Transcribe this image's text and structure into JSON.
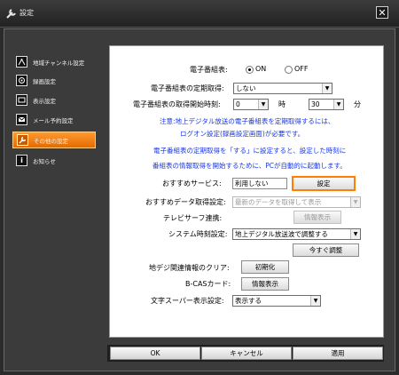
{
  "window": {
    "title": "設定",
    "close_label": "✕"
  },
  "sidebar": {
    "items": [
      {
        "label": "地域チャンネル設定",
        "icon": "tv-antenna-icon"
      },
      {
        "label": "録画設定",
        "icon": "record-icon"
      },
      {
        "label": "表示設定",
        "icon": "display-icon"
      },
      {
        "label": "メール予約設定",
        "icon": "mail-icon"
      },
      {
        "label": "その他の設定",
        "icon": "wrench-icon",
        "active": true
      },
      {
        "label": "お知らせ",
        "icon": "info-icon"
      }
    ]
  },
  "epg": {
    "label": "電子番組表:",
    "on_label": "ON",
    "off_label": "OFF",
    "selected": "ON"
  },
  "periodic": {
    "label": "電子番組表の定期取得:",
    "value": "しない"
  },
  "start_time": {
    "label": "電子番組表の取得開始時刻:",
    "hour": "0",
    "hour_unit": "時",
    "minute": "30",
    "minute_unit": "分"
  },
  "notes": {
    "line1": "注意:地上デジタル放送の電子番組表を定期取得するには、",
    "line2": "ログオン設定(録画設定画面)が必要です。",
    "line3": "電子番組表の定期取得を「する」に設定すると、設定した時刻に",
    "line4": "番組表の情報取得を開始するために、PCが自動的に起動します。"
  },
  "recommend": {
    "label": "おすすめサービス:",
    "value": "利用しない",
    "button": "設定"
  },
  "recommend_data": {
    "label": "おすすめデータ取得設定:",
    "value": "最新のデータを取得して表示"
  },
  "tv_surfer": {
    "label": "テレビサーフ連携:",
    "button": "情報表示"
  },
  "clock": {
    "label": "システム時刻設定:",
    "value": "地上デジタル放送波で調整する",
    "button": "今すぐ調整"
  },
  "clear": {
    "label": "地デジ関連情報のクリア:",
    "button": "初期化"
  },
  "bcas": {
    "label": "B-CASカード:",
    "button": "情報表示"
  },
  "teletext": {
    "label": "文字スーパー表示設定:",
    "value": "表示する"
  },
  "footer": {
    "ok": "OK",
    "cancel": "キャンセル",
    "apply": "適用"
  }
}
